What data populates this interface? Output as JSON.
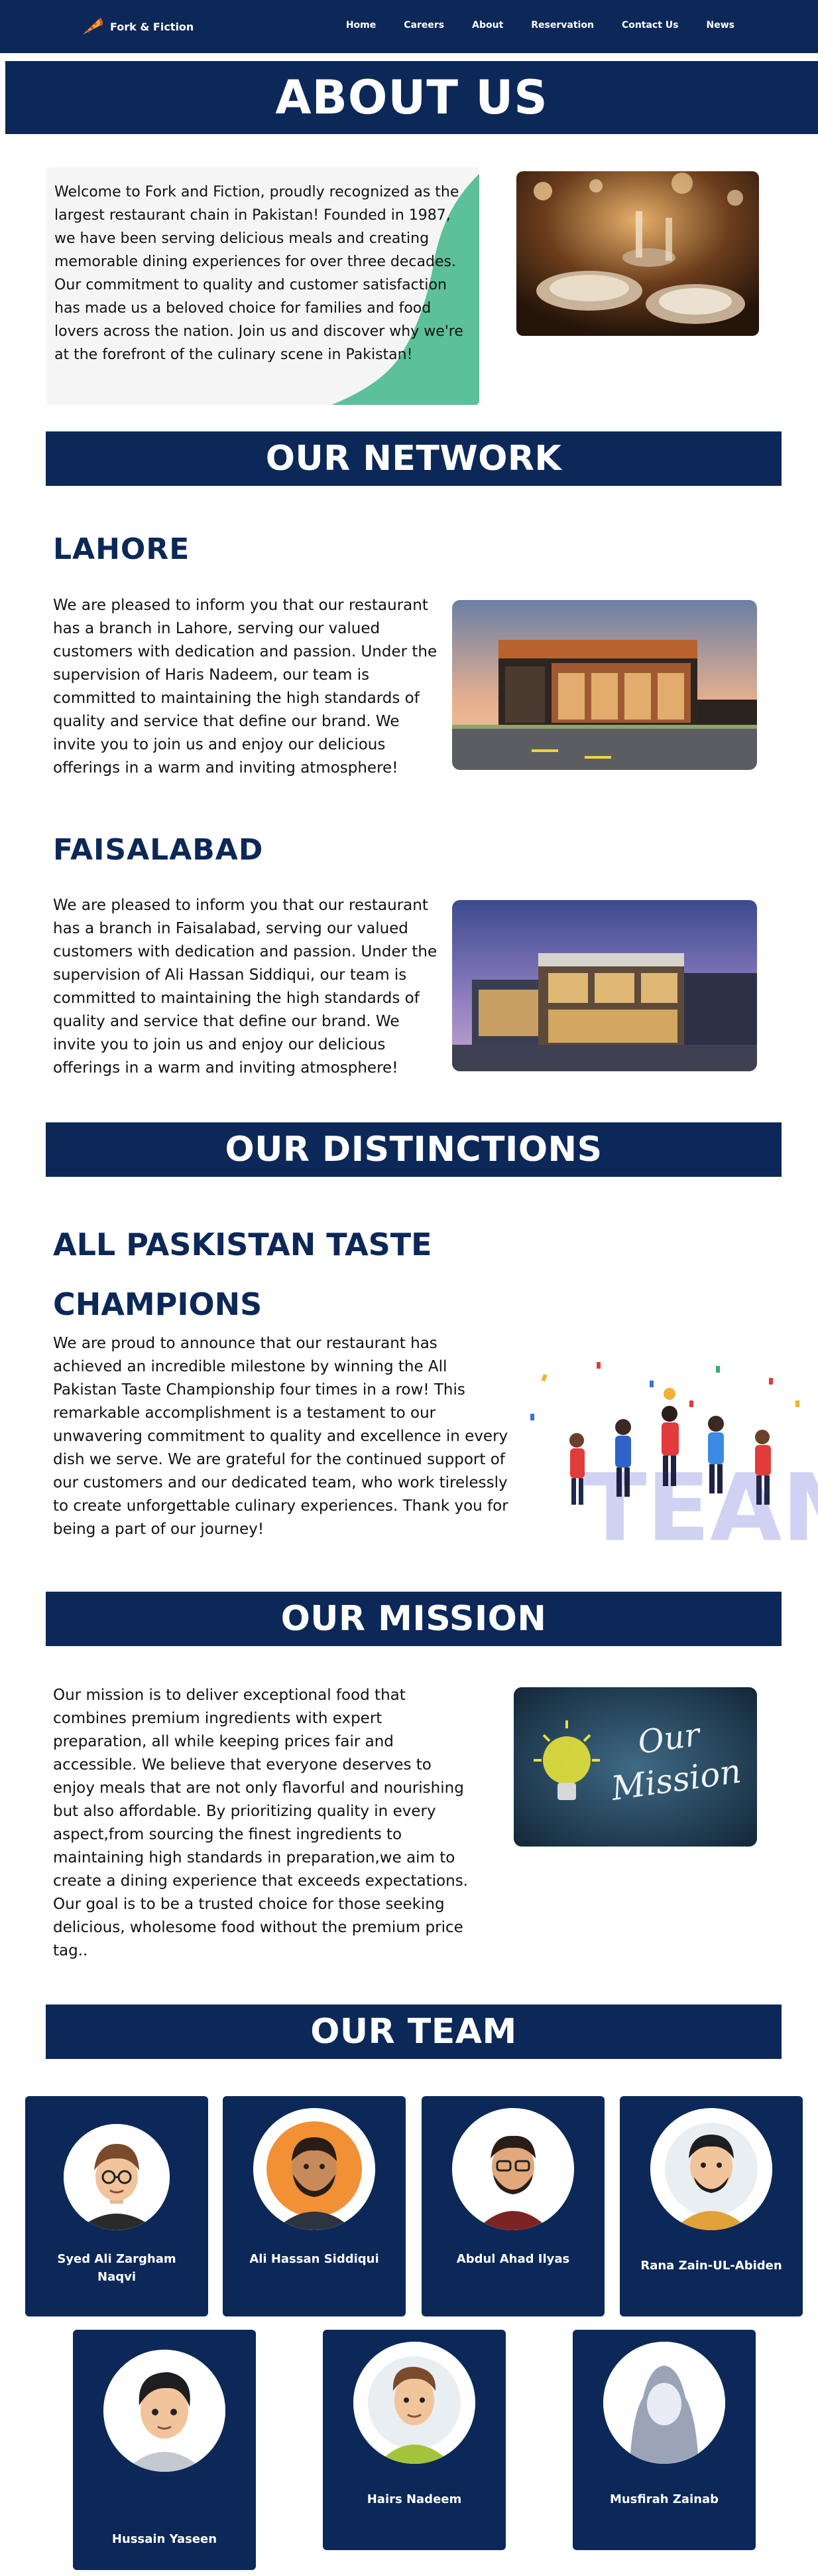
{
  "nav": {
    "brand": "Fork & Fiction",
    "links": [
      "Home",
      "Careers",
      "About",
      "Reservation",
      "Contact Us",
      "News"
    ]
  },
  "hero": {
    "title": "ABOUT US"
  },
  "about": {
    "text": "Welcome to Fork and Fiction, proudly recognized as the largest restaurant chain in Pakistan! Founded in 1987, we have been serving delicious meals and creating memorable dining experiences for over three decades. Our commitment to quality and customer satisfaction has made us a beloved choice for families and food lovers across the nation. Join us and discover why we're at the forefront of the culinary scene in Pakistan!"
  },
  "network": {
    "title": "OUR NETWORK",
    "branches": [
      {
        "city": "LAHORE",
        "text": "We are pleased to inform you that our restaurant has a branch in Lahore, serving our valued customers with dedication and passion. Under the supervision of Haris Nadeem, our team is committed to maintaining the high standards of quality and service that define our brand. We invite you to join us and enjoy our delicious offerings in a warm and inviting atmosphere!"
      },
      {
        "city": "FAISALABAD",
        "text": "We are pleased to inform you that our restaurant has a branch in Faisalabad, serving our valued customers with dedication and passion. Under the supervision of Ali Hassan Siddiqui, our team is committed to maintaining the high standards of quality and service that define our brand. We invite you to join us and enjoy our delicious offerings in a warm and inviting atmosphere!"
      }
    ]
  },
  "distinctions": {
    "title": "OUR DISTINCTIONS",
    "award_title": "ALL PASKISTAN TASTE CHAMPIONS",
    "text": "We are proud to announce that our restaurant has achieved an incredible milestone by winning the All Pakistan Taste Championship four times in a row! This remarkable accomplishment is a testament to our unwavering commitment to quality and excellence in every dish we serve. We are grateful for the continued support of our customers and our dedicated team, who work tirelessly to create unforgettable culinary experiences. Thank you for being a part of our journey!",
    "image_word": "TEAM"
  },
  "mission": {
    "title": "OUR MISSION",
    "text": "Our mission is to deliver exceptional food that combines premium ingredients with expert preparation, all while keeping prices fair and accessible. We believe that everyone deserves to enjoy meals that are not only flavorful and nourishing but also affordable. By prioritizing quality in every aspect,from sourcing the finest ingredients to maintaining high standards in preparation,we aim to create a dining experience that exceeds expectations. Our goal is to be a trusted choice for those seeking delicious, wholesome food without the premium price tag..",
    "image_line1": "Our",
    "image_line2": "Mission"
  },
  "team": {
    "title": "OUR TEAM",
    "members": [
      {
        "name": "Syed Ali Zargham Naqvi"
      },
      {
        "name": "Ali Hassan Siddiqui"
      },
      {
        "name": "Abdul Ahad Ilyas"
      },
      {
        "name": "Rana Zain-UL-Abiden"
      },
      {
        "name": "Hussain Yaseen"
      },
      {
        "name": "Hairs Nadeem"
      },
      {
        "name": "Musfirah Zainab"
      }
    ]
  },
  "colors": {
    "navy": "#0c2858",
    "accent_green": "#5cc09a",
    "card_bg": "#f5f5f5"
  },
  "icons": [
    "pizza-slice-logo-icon"
  ]
}
